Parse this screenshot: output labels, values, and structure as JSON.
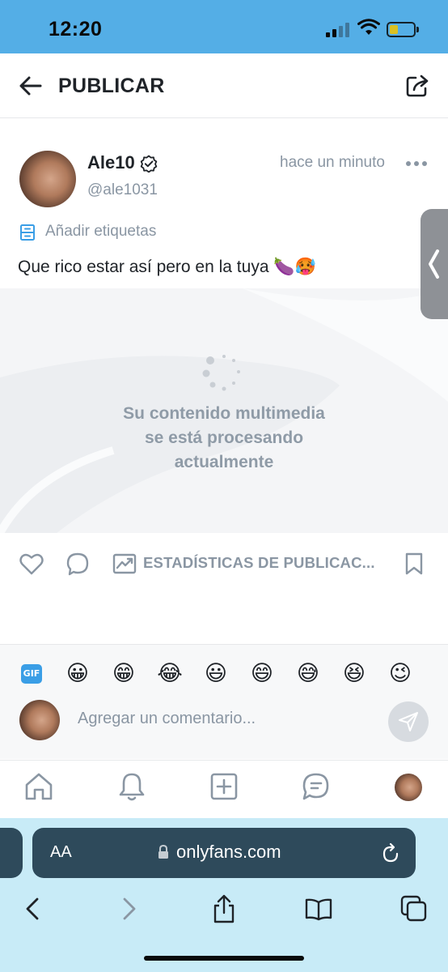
{
  "status_bar": {
    "time": "12:20",
    "icons": [
      "signal-icon",
      "wifi-icon",
      "battery-icon"
    ],
    "battery_color": "#f2c500"
  },
  "header": {
    "title": "PUBLICAR",
    "back_icon": "back-arrow-icon",
    "share_icon": "share-icon"
  },
  "post": {
    "username": "Ale10",
    "handle": "@ale1031",
    "time_ago": "hace un minuto",
    "add_tags_label": "Añadir etiquetas",
    "caption": "Que rico estar así pero en la tuya 🍆🥵",
    "processing_lines": [
      "Su contenido multimedia",
      "se está procesando",
      "actualmente"
    ]
  },
  "actions": {
    "stats_label": "ESTADÍSTICAS DE PUBLICAC...",
    "icons": [
      "like-icon",
      "comment-icon",
      "stats-icon",
      "bookmark-icon"
    ]
  },
  "comment_bar": {
    "gif_label": "GIF",
    "emojis": [
      "😀",
      "😁",
      "😂",
      "😃",
      "😄",
      "😅",
      "😆",
      "😉"
    ],
    "placeholder": "Agregar un comentario..."
  },
  "bottom_nav": {
    "items": [
      "home-icon",
      "notifications-icon",
      "add-post-icon",
      "messages-icon",
      "profile-avatar"
    ]
  },
  "browser": {
    "aa_label": "AA",
    "url": "onlyfans.com"
  },
  "colors": {
    "status_bar": "#54aee6",
    "muted_text": "#8a96a3",
    "accent": "#3a9ee6",
    "browser_bar": "#2e4a5b",
    "browser_bg": "#c8ebf7"
  }
}
